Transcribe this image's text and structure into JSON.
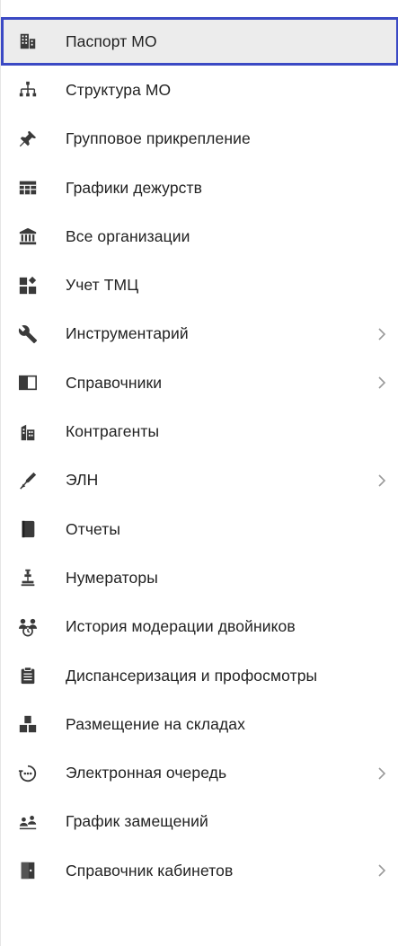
{
  "menu": {
    "items": [
      {
        "label": "Паспорт МО",
        "icon": "building-icon",
        "active": true,
        "has_submenu": false
      },
      {
        "label": "Структура МО",
        "icon": "org-structure-icon",
        "active": false,
        "has_submenu": false
      },
      {
        "label": "Групповое прикрепление",
        "icon": "pin-icon",
        "active": false,
        "has_submenu": false
      },
      {
        "label": "Графики дежурств",
        "icon": "table-grid-icon",
        "active": false,
        "has_submenu": false
      },
      {
        "label": "Все организации",
        "icon": "institution-icon",
        "active": false,
        "has_submenu": false
      },
      {
        "label": "Учет ТМЦ",
        "icon": "inventory-icon",
        "active": false,
        "has_submenu": false
      },
      {
        "label": "Инструментарий",
        "icon": "wrench-icon",
        "active": false,
        "has_submenu": true
      },
      {
        "label": "Справочники",
        "icon": "book-open-icon",
        "active": false,
        "has_submenu": true
      },
      {
        "label": "Контрагенты",
        "icon": "city-buildings-icon",
        "active": false,
        "has_submenu": false
      },
      {
        "label": "ЭЛН",
        "icon": "pen-icon",
        "active": false,
        "has_submenu": true
      },
      {
        "label": "Отчеты",
        "icon": "report-book-icon",
        "active": false,
        "has_submenu": false
      },
      {
        "label": "Нумераторы",
        "icon": "stamp-icon",
        "active": false,
        "has_submenu": false
      },
      {
        "label": "История модерации двойников",
        "icon": "people-history-icon",
        "active": false,
        "has_submenu": false
      },
      {
        "label": "Диспансеризация и профосмотры",
        "icon": "clipboard-icon",
        "active": false,
        "has_submenu": false
      },
      {
        "label": "Размещение на складах",
        "icon": "boxes-icon",
        "active": false,
        "has_submenu": false
      },
      {
        "label": "Электронная очередь",
        "icon": "queue-icon",
        "active": false,
        "has_submenu": true
      },
      {
        "label": "График замещений",
        "icon": "substitution-icon",
        "active": false,
        "has_submenu": false
      },
      {
        "label": "Справочник кабинетов",
        "icon": "door-icon",
        "active": false,
        "has_submenu": true
      }
    ]
  },
  "colors": {
    "icon": "#3a3a3a",
    "text": "#222222",
    "chevron": "#9a9a9a",
    "active_bg": "#ececec",
    "active_border": "#3b49c4"
  }
}
